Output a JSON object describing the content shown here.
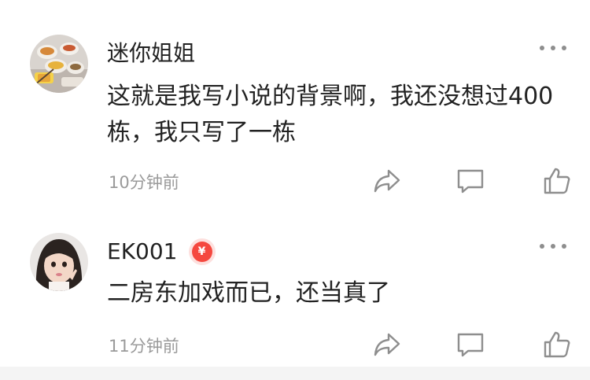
{
  "comments": [
    {
      "username": "迷你姐姐",
      "text": "这就是我写小说的背景啊，我还没想过400栋，我只写了一栋",
      "time": "10分钟前",
      "avatar_icon": "food-photo-avatar",
      "has_badge": false
    },
    {
      "username": "EK001",
      "text": "二房东加戏而已，还当真了",
      "time": "11分钟前",
      "avatar_icon": "girl-photo-avatar",
      "has_badge": true,
      "badge_symbol": "¥"
    }
  ],
  "actions": {
    "share_icon": "share-icon",
    "reply_icon": "comment-icon",
    "like_icon": "thumbs-up-icon",
    "more_icon": "more-dots-icon"
  },
  "colors": {
    "text": "#222222",
    "meta": "#9a9a9a",
    "icon": "#8e8e8e",
    "badge": "#f5483f"
  }
}
